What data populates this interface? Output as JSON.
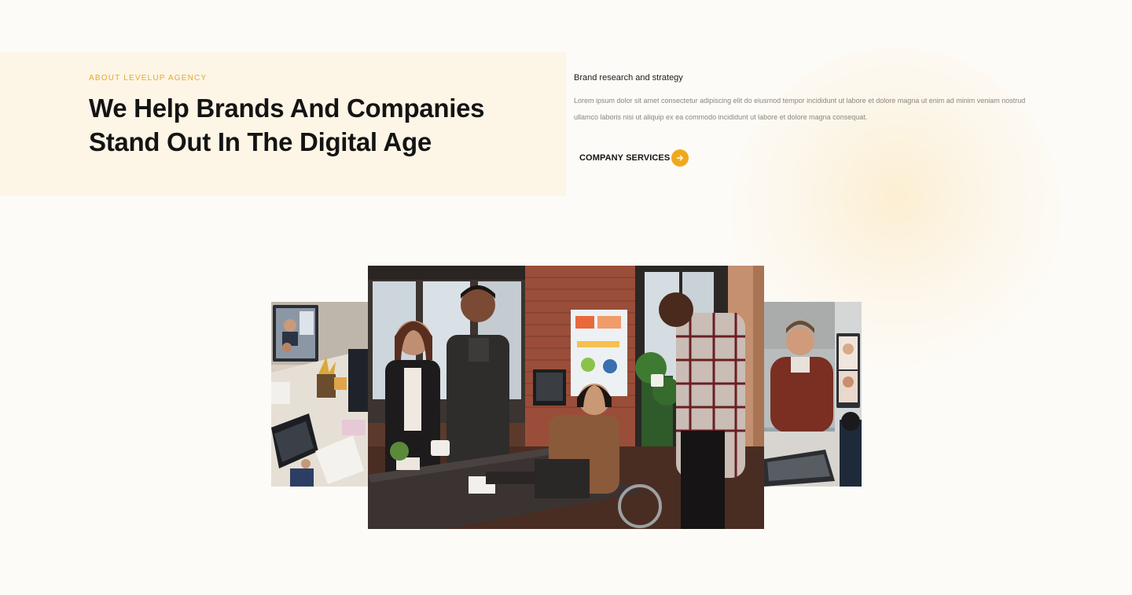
{
  "about": {
    "eyebrow": "ABOUT LEVELUP AGENCY",
    "headline": "We Help Brands And Companies Stand Out In The Digital Age"
  },
  "service": {
    "title": "Brand research and strategy",
    "description": "Lorem ipsum dolor sit amet consectetur adipiscing elit do eiusmod tempor incididunt ut labore et dolore magna ut enim ad minim veniam nostrud ullamco laboris nisi ut aliquip ex ea commodo incididunt ut labore et dolore magna consequat."
  },
  "cta": {
    "label": "COMPANY SERVICES",
    "icon": "arrow-right-icon"
  },
  "colors": {
    "accent": "#f0a91e",
    "eyebrow": "#e5a92b",
    "panel": "#fdf5e6",
    "background": "#fdfbf7",
    "headline": "#141414",
    "body_text": "#8a8680"
  },
  "gallery": {
    "images": [
      "video-call-desk-photo",
      "office-team-meeting-photo",
      "video-call-laptop-photo"
    ]
  }
}
